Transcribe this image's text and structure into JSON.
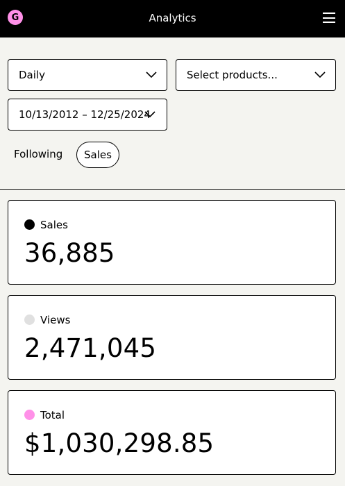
{
  "header": {
    "logo_letter": "G",
    "title": "Analytics",
    "menu_icon": "hamburger-menu-icon"
  },
  "filters": {
    "period": "Daily",
    "products": "Select products...",
    "date_range": "10/13/2012 – 12/25/2024"
  },
  "tabs": {
    "following": "Following",
    "sales": "Sales"
  },
  "colors": {
    "header_bg": "#000000",
    "accent_pink": "#ff90e8",
    "page_bg": "#f4f4f0",
    "views_dot": "#e0e0e0"
  },
  "cards": {
    "sales": {
      "label": "Sales",
      "value": "36,885",
      "dot_color": "#000000"
    },
    "views": {
      "label": "Views",
      "value": "2,471,045",
      "dot_color": "#e0e0e0"
    },
    "total": {
      "label": "Total",
      "value": "$1,030,298.85",
      "dot_color": "#ff90e8"
    }
  }
}
